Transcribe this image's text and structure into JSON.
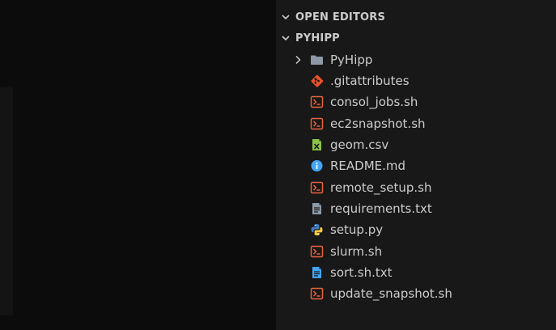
{
  "explorer": {
    "open_editors_label": "OPEN EDITORS",
    "project_label": "PYHIPP",
    "items": [
      {
        "label": "PyHipp",
        "icon": "folder-icon"
      },
      {
        "label": ".gitattributes",
        "icon": "git-icon"
      },
      {
        "label": "consol_jobs.sh",
        "icon": "shell-icon"
      },
      {
        "label": "ec2snapshot.sh",
        "icon": "shell-icon"
      },
      {
        "label": "geom.csv",
        "icon": "csv-icon"
      },
      {
        "label": "README.md",
        "icon": "info-icon"
      },
      {
        "label": "remote_setup.sh",
        "icon": "shell-icon"
      },
      {
        "label": "requirements.txt",
        "icon": "text-file-icon"
      },
      {
        "label": "setup.py",
        "icon": "python-icon"
      },
      {
        "label": "slurm.sh",
        "icon": "shell-icon"
      },
      {
        "label": "sort.sh.txt",
        "icon": "text-doc-icon"
      },
      {
        "label": "update_snapshot.sh",
        "icon": "shell-icon"
      }
    ]
  },
  "colors": {
    "shell": "#e8643c",
    "git": "#e8512b",
    "csv": "#8bc34a",
    "info": "#42a5f5",
    "folder": "#8d99a6",
    "text_doc": "#42a5f5"
  }
}
